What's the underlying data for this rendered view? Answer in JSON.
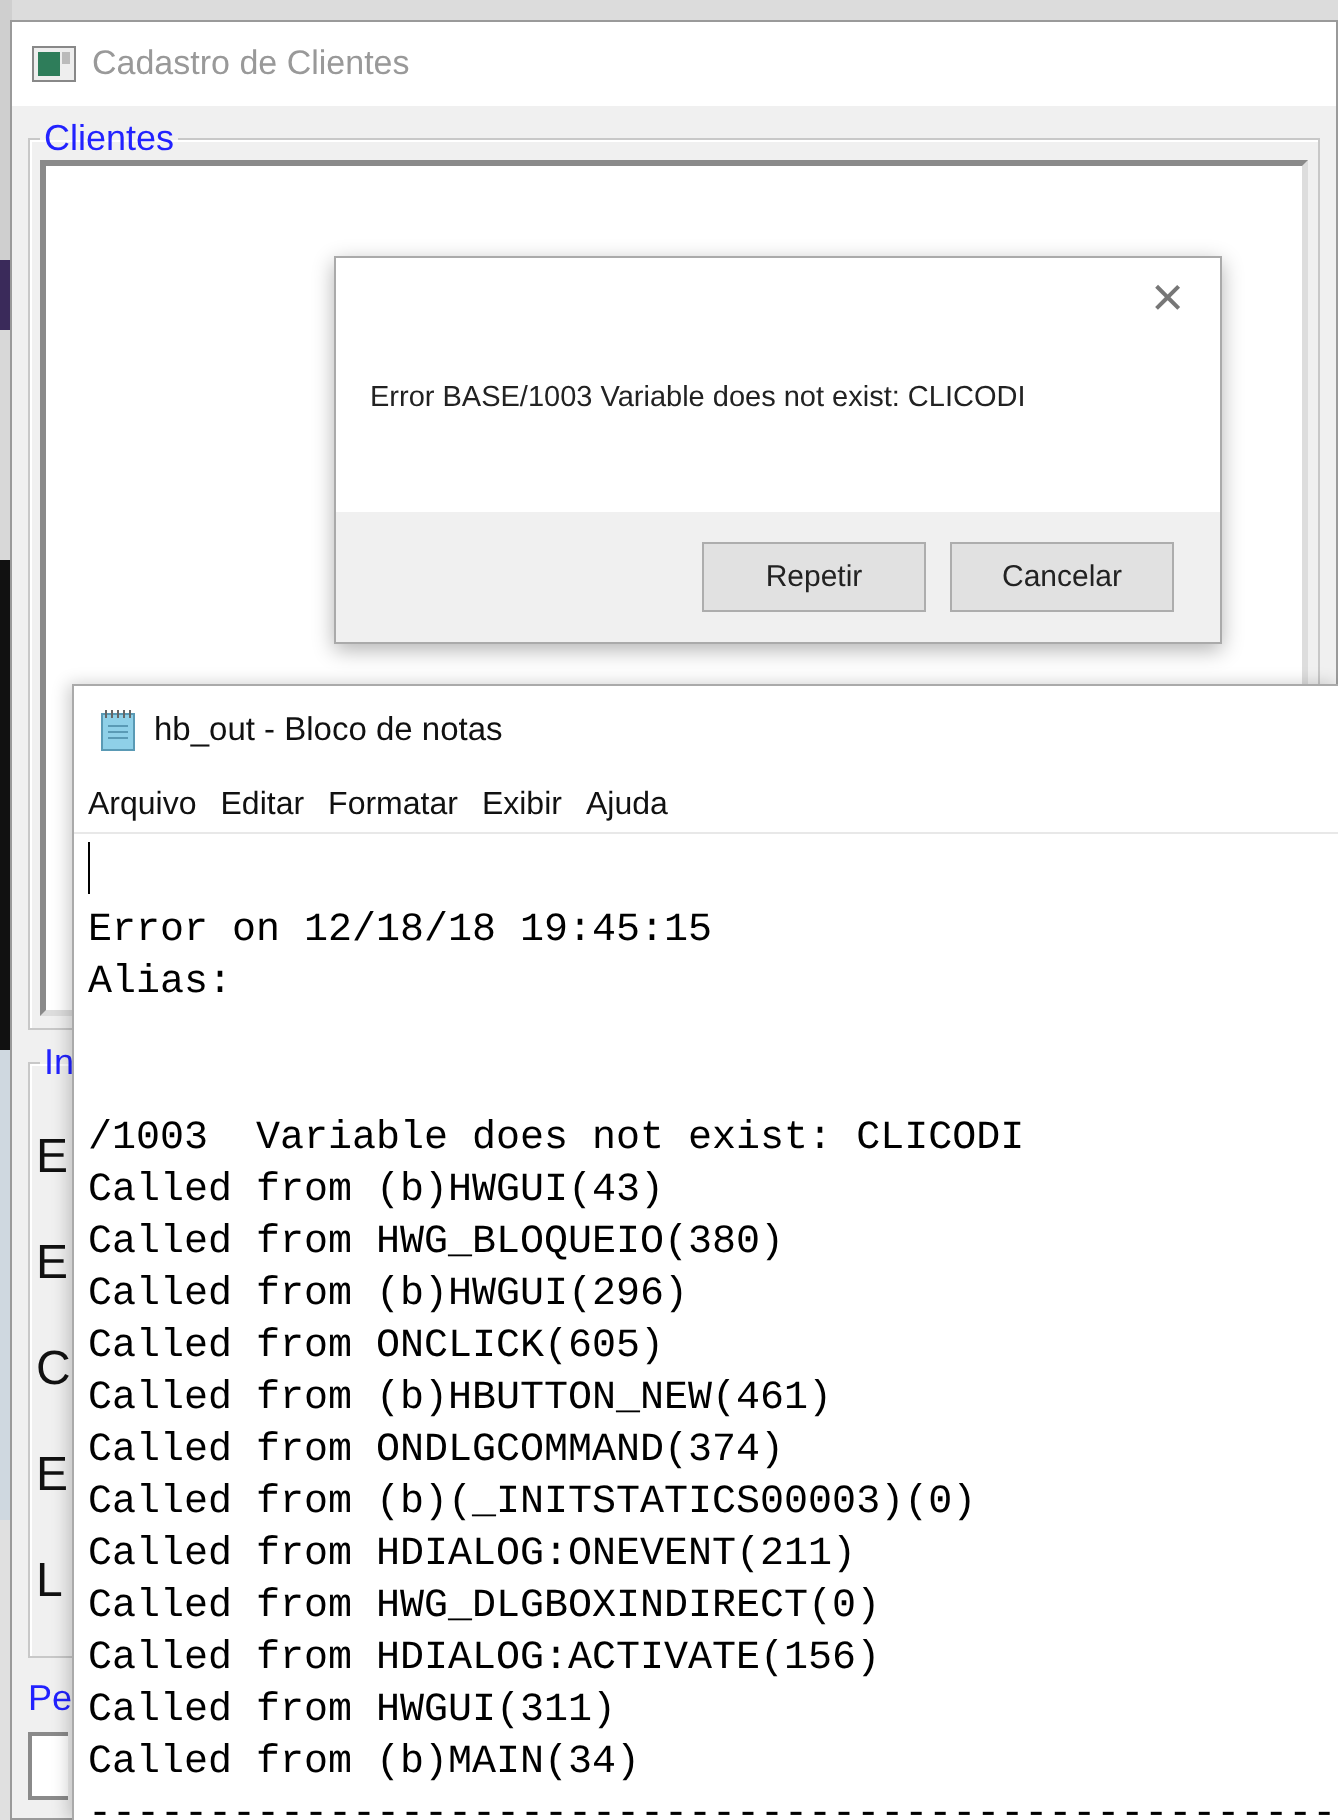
{
  "main_window": {
    "title": "Cadastro de Clientes",
    "groups": [
      {
        "label": "Clientes"
      },
      {
        "label": "In",
        "letters": [
          "E",
          "E",
          "C",
          "E",
          "L"
        ]
      }
    ],
    "field_label": "Pe"
  },
  "error_dialog": {
    "close": "×",
    "message": "Error BASE/1003  Variable does not exist: CLICODI",
    "buttons": [
      "Repetir",
      "Cancelar"
    ]
  },
  "notepad": {
    "title": "hb_out - Bloco de notas",
    "menu": [
      "Arquivo",
      "Editar",
      "Formatar",
      "Exibir",
      "Ajuda"
    ],
    "blocks": [
      [
        "Error on 12/18/18 19:45:15",
        "Alias:"
      ],
      [
        "/1003  Variable does not exist: CLICODI",
        "Called from (b)HWGUI(43)",
        "Called from HWG_BLOQUEIO(380)",
        "Called from (b)HWGUI(296)",
        "Called from ONCLICK(605)",
        "Called from (b)HBUTTON_NEW(461)",
        "Called from ONDLGCOMMAND(374)",
        "Called from (b)(_INITSTATICS00003)(0)",
        "Called from HDIALOG:ONEVENT(211)",
        "Called from HWG_DLGBOXINDIRECT(0)",
        "Called from HDIALOG:ACTIVATE(156)",
        "Called from HWGUI(311)",
        "Called from (b)MAIN(34)",
        "----------------------------------------------------"
      ]
    ]
  }
}
